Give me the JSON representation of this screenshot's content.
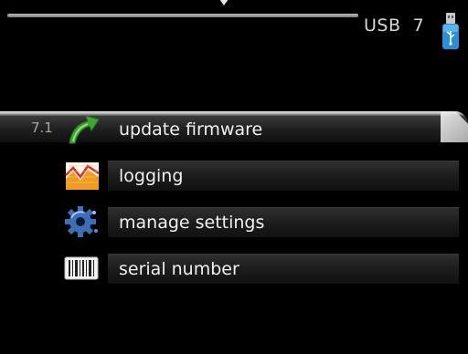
{
  "header": {
    "title": "USB  7",
    "usb_icon": "usb-stick-icon"
  },
  "menu": {
    "items": [
      {
        "number": "7.1",
        "label": "update firmware",
        "icon": "update-arrow-icon",
        "selected": true
      },
      {
        "number": "",
        "label": "logging",
        "icon": "logging-chart-icon",
        "selected": false
      },
      {
        "number": "",
        "label": "manage settings",
        "icon": "settings-gear-icon",
        "selected": false
      },
      {
        "number": "",
        "label": "serial number",
        "icon": "barcode-icon",
        "selected": false
      }
    ]
  },
  "colors": {
    "background": "#000000",
    "text": "#f0f0f0",
    "accent_green": "#3fa535",
    "usb_blue": "#2b8fd6"
  }
}
